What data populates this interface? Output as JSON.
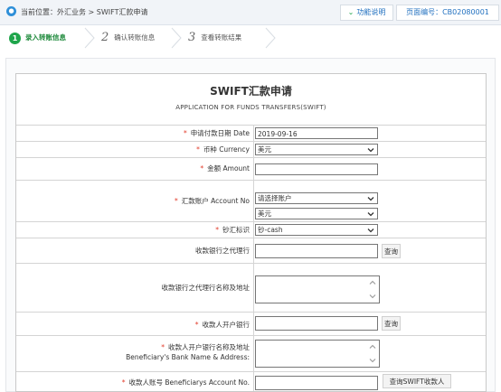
{
  "header": {
    "location_icon": "location-pin-icon",
    "location": "当前位置：外汇业务 > SWIFT汇款申请",
    "help_label": "功能说明",
    "page_no": "页面编号：CB02080001"
  },
  "steps": [
    {
      "num": "1",
      "label": "录入转账信息"
    },
    {
      "num": "2",
      "label": "确认转账信息"
    },
    {
      "num": "3",
      "label": "查看转账结果"
    }
  ],
  "form": {
    "title": "SWIFT汇款申请",
    "subtitle": "APPLICATION FOR FUNDS TRANSFERS(SWIFT)",
    "date": {
      "label": "申请付款日期 Date",
      "value": "2019-09-16"
    },
    "currency": {
      "label": "币种 Currency",
      "value": "美元"
    },
    "amount": {
      "label": "金额 Amount",
      "value": ""
    },
    "account": {
      "label": "汇款账户 Account No",
      "value": "请选择账户",
      "currency_value": "美元"
    },
    "cash_flag": {
      "label": "钞汇标识",
      "value": "钞-cash"
    },
    "agent_bank": {
      "label": "收款银行之代理行",
      "query_label": "查询"
    },
    "agent_bank_addr": {
      "label": "收款银行之代理行名称及地址"
    },
    "bene_bank": {
      "label": "收款人开户银行",
      "query_label": "查询"
    },
    "bene_bank_addr": {
      "label_cn": "收款人开户银行名称及地址",
      "label_en": "Beneficiary's Bank Name & Address:"
    },
    "bene_account": {
      "label": "收款人账号 Beneficiarys Account No.",
      "query_label": "查询SWIFT收款人"
    }
  },
  "colors": {
    "accent": "#1fa54b",
    "link": "#1f6fbf",
    "required": "#e23b2a"
  }
}
